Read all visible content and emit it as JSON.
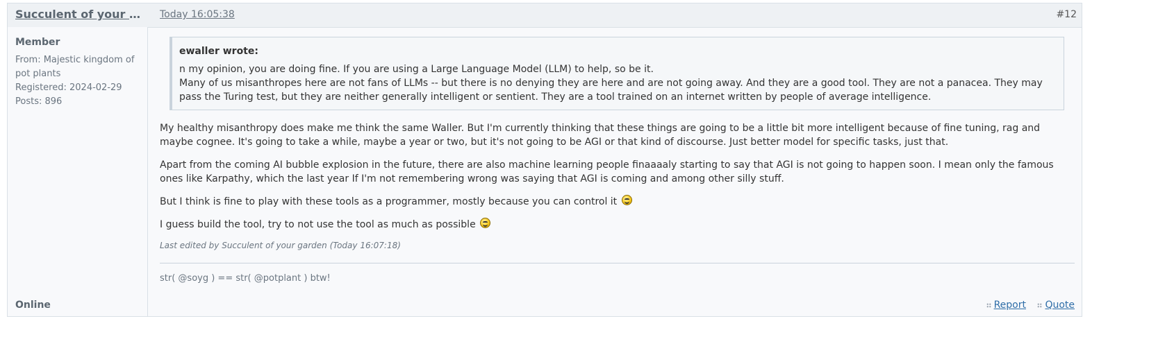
{
  "header": {
    "author": "Succulent of your garden",
    "time": "Today 16:05:38",
    "number": "#12"
  },
  "author_info": {
    "rank": "Member",
    "from": "From: Majestic kingdom of pot plants",
    "registered": "Registered: 2024-02-29",
    "posts": "Posts: 896",
    "status": "Online"
  },
  "quote": {
    "author": "ewaller wrote:",
    "line1": "n my opinion, you are doing fine.  If you are using a Large Language Model (LLM) to help, so be it.",
    "line2": "Many of us misanthropes here are not fans of LLMs -- but there is no denying they are here and are not going away. And they are a good tool.  They are not a panacea.  They may pass the Turing test, but they are neither generally intelligent or sentient.  They are a tool trained on an internet written by people of average intelligence."
  },
  "body": {
    "p1": "My healthy misanthropy does make me think the same Waller. But I'm currently thinking that these things are going to be a little bit more intelligent because of fine tuning, rag and maybe cognee. It's going to take a while, maybe a year or two, but it's not going to be AGI or that kind of discourse. Just better model for specific tasks, just that.",
    "p2": "Apart from the coming AI bubble explosion in the future, there are also machine learning people finaaaaly starting to say that AGI is not going to happen soon. I mean only the famous ones like Karpathy, which the last year If I'm not remembering wrong was saying that AGI is coming and among other silly stuff.",
    "p3": "But I think is fine to play with these tools as a programmer, mostly because you can control it",
    "p4": "I guess build the tool, try to not use the tool as much as possible"
  },
  "edited": "Last edited by Succulent of your garden (Today 16:07:18)",
  "signature": "str( @soyg ) == str( @potplant ) btw!",
  "actions": {
    "report": "Report",
    "quote": "Quote"
  },
  "icons": {
    "smiley": "tongue-smiley-icon",
    "action": "grip-icon"
  }
}
